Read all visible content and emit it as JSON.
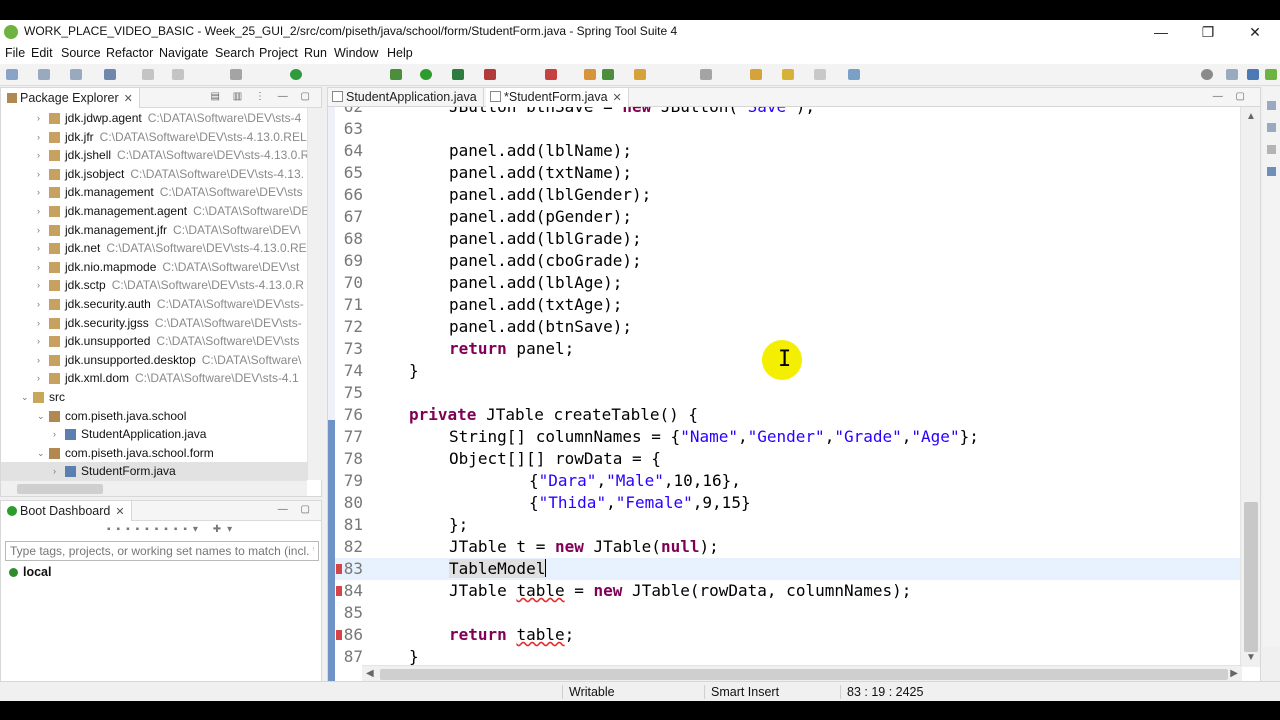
{
  "window": {
    "title": "WORK_PLACE_VIDEO_BASIC - Week_25_GUI_2/src/com/piseth/java/school/form/StudentForm.java - Spring Tool Suite 4",
    "minimize": "—",
    "restore": "❐",
    "close": "✕"
  },
  "menu": [
    "File",
    "Edit",
    "Source",
    "Refactor",
    "Navigate",
    "Search",
    "Project",
    "Run",
    "Window",
    "Help"
  ],
  "package_explorer": {
    "tab_label": "Package Explorer",
    "close": "✕",
    "items": [
      {
        "label": "jdk.jdwp.agent",
        "path": "C:\\DATA\\Software\\DEV\\sts-4",
        "arrow": "›",
        "type": "jar"
      },
      {
        "label": "jdk.jfr",
        "path": "C:\\DATA\\Software\\DEV\\sts-4.13.0.REL",
        "arrow": "›",
        "type": "jar"
      },
      {
        "label": "jdk.jshell",
        "path": "C:\\DATA\\Software\\DEV\\sts-4.13.0.R",
        "arrow": "›",
        "type": "jar"
      },
      {
        "label": "jdk.jsobject",
        "path": "C:\\DATA\\Software\\DEV\\sts-4.13.",
        "arrow": "›",
        "type": "jar"
      },
      {
        "label": "jdk.management",
        "path": "C:\\DATA\\Software\\DEV\\sts",
        "arrow": "›",
        "type": "jar"
      },
      {
        "label": "jdk.management.agent",
        "path": "C:\\DATA\\Software\\DEV\\D",
        "arrow": "›",
        "type": "jar"
      },
      {
        "label": "jdk.management.jfr",
        "path": "C:\\DATA\\Software\\DEV\\",
        "arrow": "›",
        "type": "jar"
      },
      {
        "label": "jdk.net",
        "path": "C:\\DATA\\Software\\DEV\\sts-4.13.0.RE",
        "arrow": "›",
        "type": "jar"
      },
      {
        "label": "jdk.nio.mapmode",
        "path": "C:\\DATA\\Software\\DEV\\st",
        "arrow": "›",
        "type": "jar"
      },
      {
        "label": "jdk.sctp",
        "path": "C:\\DATA\\Software\\DEV\\sts-4.13.0.R",
        "arrow": "›",
        "type": "jar"
      },
      {
        "label": "jdk.security.auth",
        "path": "C:\\DATA\\Software\\DEV\\sts-",
        "arrow": "›",
        "type": "jar"
      },
      {
        "label": "jdk.security.jgss",
        "path": "C:\\DATA\\Software\\DEV\\sts-",
        "arrow": "›",
        "type": "jar"
      },
      {
        "label": "jdk.unsupported",
        "path": "C:\\DATA\\Software\\DEV\\sts",
        "arrow": "›",
        "type": "jar"
      },
      {
        "label": "jdk.unsupported.desktop",
        "path": "C:\\DATA\\Software\\",
        "arrow": "›",
        "type": "jar"
      },
      {
        "label": "jdk.xml.dom",
        "path": "C:\\DATA\\Software\\DEV\\sts-4.1",
        "arrow": "›",
        "type": "jar"
      },
      {
        "label": "src",
        "path": "",
        "arrow": "⌄",
        "type": "folder"
      },
      {
        "label": "com.piseth.java.school",
        "path": "",
        "arrow": "⌄",
        "type": "package"
      },
      {
        "label": "StudentApplication.java",
        "path": "",
        "arrow": "›",
        "type": "java"
      },
      {
        "label": "com.piseth.java.school.form",
        "path": "",
        "arrow": "⌄",
        "type": "package"
      },
      {
        "label": "StudentForm.java",
        "path": "",
        "arrow": "›",
        "type": "java",
        "selected": true
      }
    ]
  },
  "boot_dashboard": {
    "tab_label": "Boot Dashboard",
    "close": "✕",
    "search_placeholder": "Type tags, projects, or working set names to match (incl. *",
    "items": [
      "local"
    ]
  },
  "editor": {
    "tabs": [
      {
        "label": "StudentApplication.java",
        "active": false
      },
      {
        "label": "*StudentForm.java",
        "active": true,
        "close": "✕"
      }
    ],
    "current_line": 83,
    "lines": [
      {
        "n": "62",
        "code": "JButton btnSave = new JButton(\"Save\");",
        "indent": 2
      },
      {
        "n": "63",
        "code": "",
        "indent": 0
      },
      {
        "n": "64",
        "code": "panel.add(lblName);",
        "indent": 2
      },
      {
        "n": "65",
        "code": "panel.add(txtName);",
        "indent": 2
      },
      {
        "n": "66",
        "code": "panel.add(lblGender);",
        "indent": 2
      },
      {
        "n": "67",
        "code": "panel.add(pGender);",
        "indent": 2
      },
      {
        "n": "68",
        "code": "panel.add(lblGrade);",
        "indent": 2
      },
      {
        "n": "69",
        "code": "panel.add(cboGrade);",
        "indent": 2
      },
      {
        "n": "70",
        "code": "panel.add(lblAge);",
        "indent": 2
      },
      {
        "n": "71",
        "code": "panel.add(txtAge);",
        "indent": 2
      },
      {
        "n": "72",
        "code": "panel.add(btnSave);",
        "indent": 2
      },
      {
        "n": "73",
        "code": "return panel;",
        "indent": 2
      },
      {
        "n": "74",
        "code": "}",
        "indent": 1
      },
      {
        "n": "75",
        "code": "",
        "indent": 0
      },
      {
        "n": "76",
        "code": "private JTable createTable() {",
        "indent": 1
      },
      {
        "n": "77",
        "code": "String[] columnNames = {\"Name\",\"Gender\",\"Grade\",\"Age\"};",
        "indent": 2
      },
      {
        "n": "78",
        "code": "Object[][] rowData = {",
        "indent": 2
      },
      {
        "n": "79",
        "code": "{\"Dara\",\"Male\",10,16},",
        "indent": 4
      },
      {
        "n": "80",
        "code": "{\"Thida\",\"Female\",9,15}",
        "indent": 4
      },
      {
        "n": "81",
        "code": "};",
        "indent": 2
      },
      {
        "n": "82",
        "code": "JTable t = new JTable(null);",
        "indent": 2
      },
      {
        "n": "83",
        "code": "TableModel",
        "indent": 2
      },
      {
        "n": "84",
        "code": "JTable table = new JTable(rowData, columnNames);",
        "indent": 2
      },
      {
        "n": "85",
        "code": "",
        "indent": 0
      },
      {
        "n": "86",
        "code": "return table;",
        "indent": 2
      },
      {
        "n": "87",
        "code": "}",
        "indent": 1
      }
    ]
  },
  "status": {
    "mode": "Writable",
    "insert": "Smart Insert",
    "position": "83 : 19 : 2425"
  },
  "colors": {
    "keyword": "#7f0055",
    "string": "#2a00ff",
    "current_line": "#e8f2fe",
    "ruler_highlight": "#6f93c7",
    "spring_green": "#6db33f",
    "cursor_highlight": "#f4ee00"
  }
}
